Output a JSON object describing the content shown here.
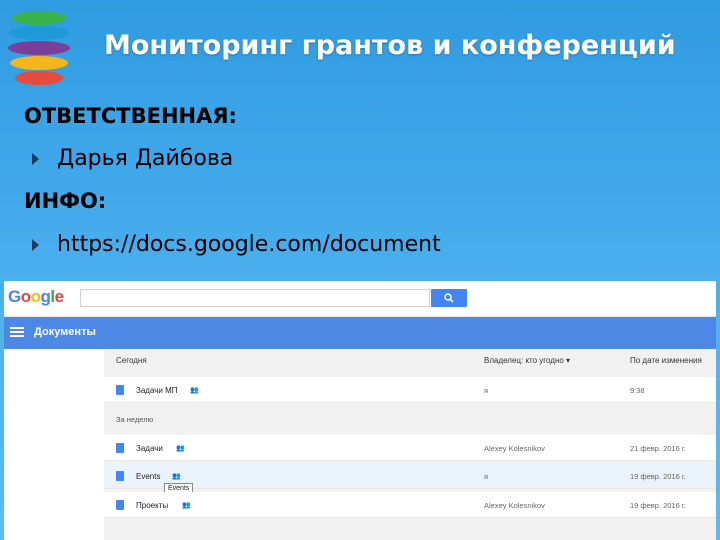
{
  "slide": {
    "title": "Мониторинг грантов и конференций",
    "responsible_label": "ОТВЕТСТВЕННАЯ:",
    "responsible_name": "Дарья Дайбова",
    "info_label": "ИНФО:",
    "info_link": "https://docs.google.com/document"
  },
  "colors": {
    "background": "#3ea7ea",
    "docs_bar": "#4e88e6",
    "search_button": "#4285f4",
    "logo_stripes": [
      "#3ab24a",
      "#1e9ad6",
      "#7b3f98",
      "#f7b51c",
      "#e84a3c"
    ]
  },
  "screenshot": {
    "google_logo": "Google",
    "search_icon": "search-icon",
    "docs_title": "Документы",
    "columns": {
      "name": "Сегодня",
      "owner": "Владелец: кто угодно ▾",
      "modified": "По дате изменения"
    },
    "today_docs": [
      {
        "name": "Задачи МП",
        "owner": "я",
        "modified": "9:38"
      }
    ],
    "week_label": "За неделю",
    "week_docs": [
      {
        "name": "Задачи",
        "owner": "Alexey Kolesnikov",
        "modified": "21 февр. 2016 г."
      },
      {
        "name": "Events",
        "owner": "я",
        "modified": "19 февр. 2016 г.",
        "tooltip": "Events"
      },
      {
        "name": "Проекты",
        "owner": "Alexey Kolesnikov",
        "modified": "19 февр. 2016 г."
      }
    ]
  }
}
